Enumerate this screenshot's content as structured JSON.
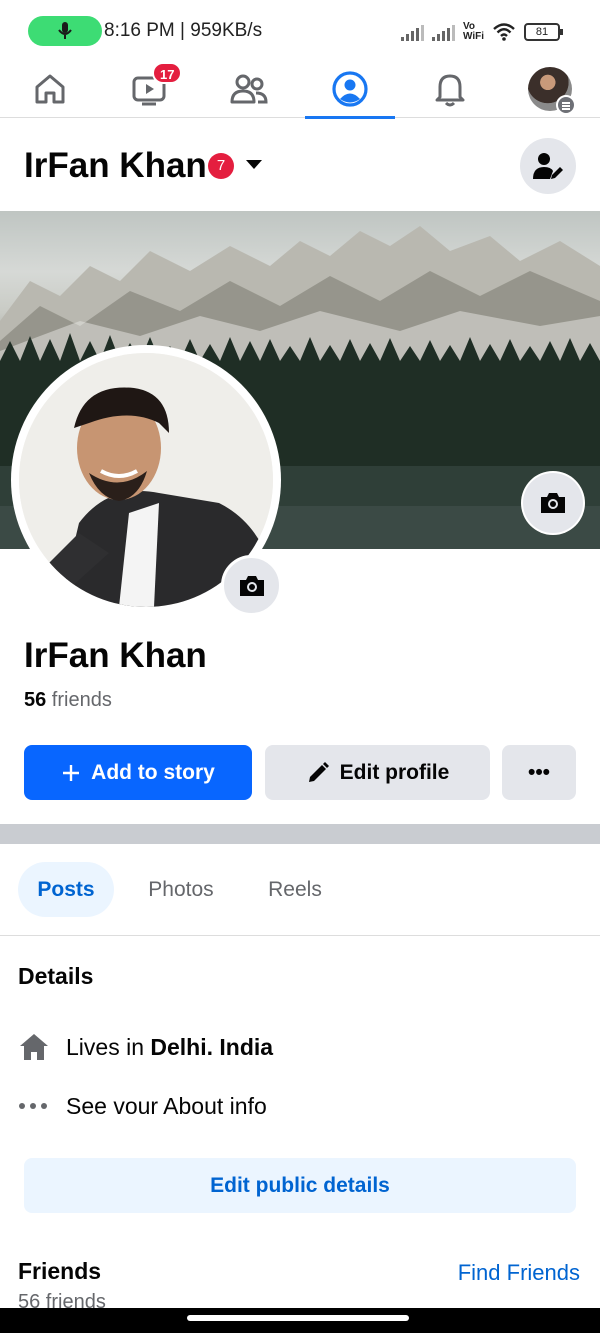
{
  "status_bar": {
    "time_speed": "8:16 PM | 959KB/s",
    "vowifi_line1": "Vo",
    "vowifi_line2": "WiFi",
    "battery": "81"
  },
  "nav": {
    "items": [
      {
        "name": "home",
        "icon": "home-icon"
      },
      {
        "name": "video",
        "icon": "video-icon",
        "badge": "17"
      },
      {
        "name": "friends",
        "icon": "friends-icon"
      },
      {
        "name": "profile",
        "icon": "profile-icon",
        "active": true
      },
      {
        "name": "notifications",
        "icon": "bell-icon"
      },
      {
        "name": "menu",
        "icon": "menu-avatar"
      }
    ]
  },
  "header": {
    "name": "IrFan Khan",
    "badge": "7"
  },
  "profile": {
    "name": "IrFan Khan",
    "friends_count": "56",
    "friends_word": " friends"
  },
  "actions": {
    "add_story": "Add to story",
    "edit_profile": "Edit profile",
    "more": "•••"
  },
  "tabs": [
    {
      "label": "Posts",
      "active": true
    },
    {
      "label": "Photos"
    },
    {
      "label": "Reels"
    }
  ],
  "details": {
    "title": "Details",
    "lives_prefix": "Lives in ",
    "lives_place": "Delhi. India",
    "about": "See vour About info",
    "edit_public": "Edit public details"
  },
  "friends_section": {
    "title": "Friends",
    "find": "Find Friends",
    "count": "56 friends"
  },
  "colors": {
    "accent": "#0866ff",
    "link": "#0064d1",
    "badge": "#e41e3f"
  }
}
